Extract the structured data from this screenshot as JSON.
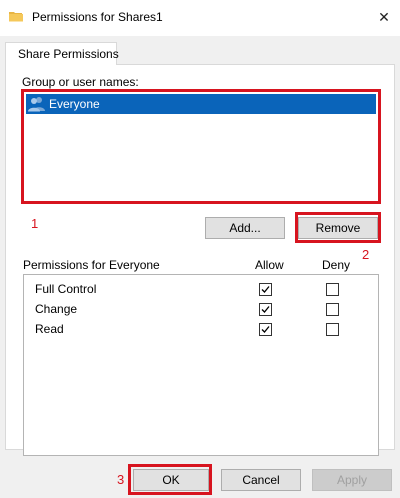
{
  "window": {
    "title": "Permissions for Shares1",
    "close_glyph": "✕",
    "icons": {
      "folder": "folder-icon",
      "close": "close-icon"
    }
  },
  "tabs": [
    {
      "label": "Share Permissions",
      "selected": true
    }
  ],
  "group_section": {
    "label": "Group or user names:",
    "users": [
      {
        "name": "Everyone",
        "icon": "users-icon",
        "selected": true
      }
    ]
  },
  "buttons": {
    "add": "Add...",
    "remove": "Remove",
    "ok": "OK",
    "cancel": "Cancel",
    "apply": "Apply"
  },
  "permissions": {
    "title": "Permissions for Everyone",
    "allow_header": "Allow",
    "deny_header": "Deny",
    "rows": [
      {
        "name": "Full Control",
        "allow": true,
        "deny": false
      },
      {
        "name": "Change",
        "allow": true,
        "deny": false
      },
      {
        "name": "Read",
        "allow": true,
        "deny": false
      }
    ]
  },
  "annotations": {
    "marker_1": "1",
    "marker_2": "2",
    "marker_3": "3"
  },
  "colors": {
    "selection": "#0a64ba",
    "annotation_red": "#d7141f",
    "dialog_background": "#f0f0f0",
    "button_background": "#e1e1e1"
  }
}
